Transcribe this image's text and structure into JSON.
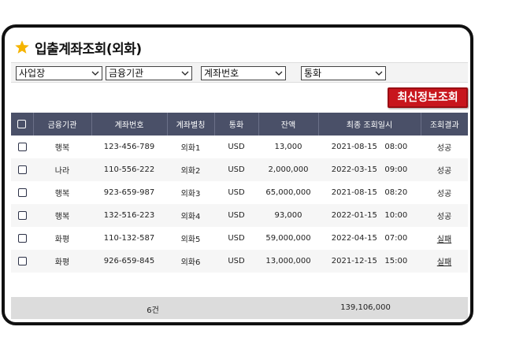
{
  "header": {
    "title": "입출계좌조회(외화)",
    "icon": "star-icon",
    "icon_color": "#f5b400"
  },
  "filters": [
    {
      "label": "사업장"
    },
    {
      "label": "금융기관"
    },
    {
      "label": "계좌번호"
    },
    {
      "label": "통화"
    }
  ],
  "toolbar": {
    "refresh_label": "최신정보조회",
    "refresh_color": "#c8161d"
  },
  "table": {
    "columns": [
      "금융기관",
      "계좌번호",
      "계좌별칭",
      "통화",
      "잔액",
      "최종 조회일시",
      "조회결과"
    ],
    "rows": [
      {
        "bank": "행복",
        "account": "123-456-789",
        "alias": "외화1",
        "currency": "USD",
        "balance": "13,000",
        "datetime": "2021-08-15   08:00",
        "result": "성공",
        "status": "success"
      },
      {
        "bank": "나라",
        "account": "110-556-222",
        "alias": "외화2",
        "currency": "USD",
        "balance": "2,000,000",
        "datetime": "2022-03-15   09:00",
        "result": "성공",
        "status": "success"
      },
      {
        "bank": "행복",
        "account": "923-659-987",
        "alias": "외화3",
        "currency": "USD",
        "balance": "65,000,000",
        "datetime": "2021-08-15   08:20",
        "result": "성공",
        "status": "success"
      },
      {
        "bank": "행복",
        "account": "132-516-223",
        "alias": "외화4",
        "currency": "USD",
        "balance": "93,000",
        "datetime": "2022-01-15   10:00",
        "result": "성공",
        "status": "success"
      },
      {
        "bank": "화평",
        "account": "110-132-587",
        "alias": "외화5",
        "currency": "USD",
        "balance": "59,000,000",
        "datetime": "2022-04-15   07:00",
        "result": "실패",
        "status": "fail"
      },
      {
        "bank": "화평",
        "account": "926-659-845",
        "alias": "외화6",
        "currency": "USD",
        "balance": "13,000,000",
        "datetime": "2021-12-15   15:00",
        "result": "실패",
        "status": "fail"
      }
    ]
  },
  "footer": {
    "count": "6건",
    "total": "139,106,000"
  },
  "colors": {
    "header_bg": "#4a5068",
    "fail": "#e0141e"
  }
}
